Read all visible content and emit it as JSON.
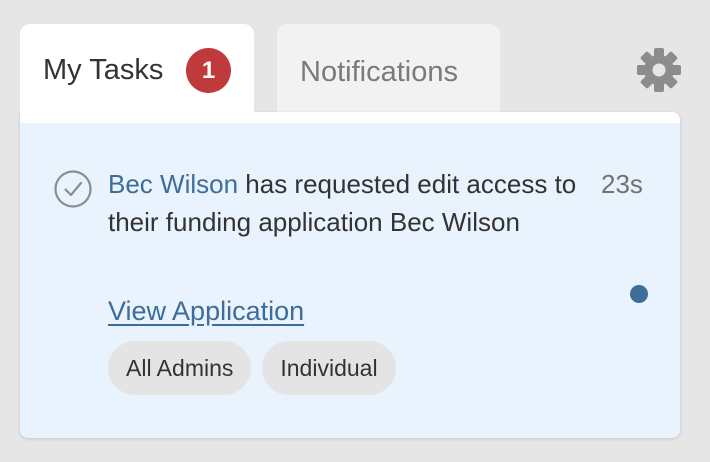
{
  "tabs": {
    "my_tasks": {
      "label": "My Tasks",
      "badge_count": "1"
    },
    "notifications": {
      "label": "Notifications"
    }
  },
  "settings_icon": "gear-icon",
  "task": {
    "icon": "check-circle-icon",
    "user_name": "Bec Wilson",
    "message_text": " has requested edit access to their funding application Bec Wilson",
    "time": "23s",
    "link_label": "View Application",
    "tags": [
      "All Admins",
      "Individual"
    ],
    "unread": true
  },
  "colors": {
    "accent": "#3d6d98",
    "badge": "#c0393b",
    "task_background": "#e8f3fd",
    "page_background": "#e6e6e6"
  }
}
